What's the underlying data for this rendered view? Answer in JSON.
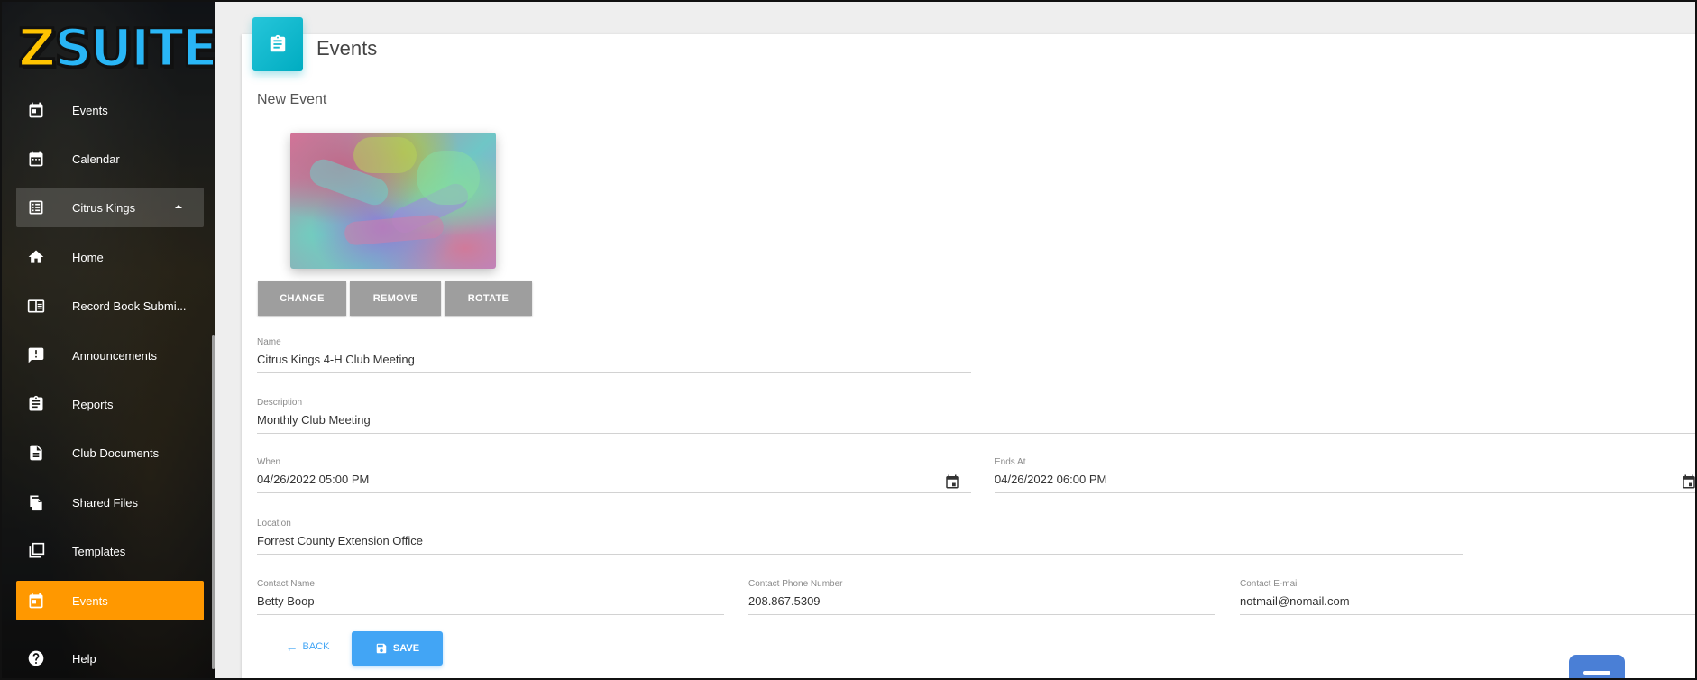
{
  "app": {
    "logo_text": "ZSUITE",
    "logo_z": "Z",
    "logo_rest": "SUITE"
  },
  "sidebar": {
    "items": [
      {
        "label": "Events",
        "icon": "calendar-event-icon"
      },
      {
        "label": "Calendar",
        "icon": "calendar-icon"
      },
      {
        "label": "Citrus Kings",
        "icon": "list-icon",
        "expanded": true
      },
      {
        "label": "Home",
        "icon": "home-icon"
      },
      {
        "label": "Record Book Submi...",
        "icon": "book-icon"
      },
      {
        "label": "Announcements",
        "icon": "announcement-icon"
      },
      {
        "label": "Reports",
        "icon": "clipboard-icon"
      },
      {
        "label": "Club Documents",
        "icon": "document-icon"
      },
      {
        "label": "Shared Files",
        "icon": "files-icon"
      },
      {
        "label": "Templates",
        "icon": "templates-icon"
      },
      {
        "label": "Events",
        "icon": "calendar-event-icon",
        "active": true
      },
      {
        "label": "Help",
        "icon": "help-icon"
      }
    ]
  },
  "page": {
    "title": "Events",
    "subtitle": "New Event"
  },
  "image_buttons": {
    "change": "CHANGE",
    "remove": "REMOVE",
    "rotate": "ROTATE"
  },
  "form": {
    "name": {
      "label": "Name",
      "value": "Citrus Kings 4-H Club Meeting"
    },
    "description": {
      "label": "Description",
      "value": "Monthly Club Meeting"
    },
    "when": {
      "label": "When",
      "value": "04/26/2022 05:00 PM"
    },
    "ends_at": {
      "label": "Ends At",
      "value": "04/26/2022 06:00 PM"
    },
    "location": {
      "label": "Location",
      "value": "Forrest County Extension Office"
    },
    "contact_name": {
      "label": "Contact Name",
      "value": "Betty Boop"
    },
    "contact_phone": {
      "label": "Contact Phone Number",
      "value": "208.867.5309"
    },
    "contact_email": {
      "label": "Contact E-mail",
      "value": "notmail@nomail.com"
    }
  },
  "actions": {
    "back": "BACK",
    "save": "SAVE"
  },
  "colors": {
    "accent_orange": "#ff9800",
    "primary_blue": "#42a5f5",
    "card_icon_teal": "#00acc1",
    "button_gray": "#9e9e9e"
  }
}
